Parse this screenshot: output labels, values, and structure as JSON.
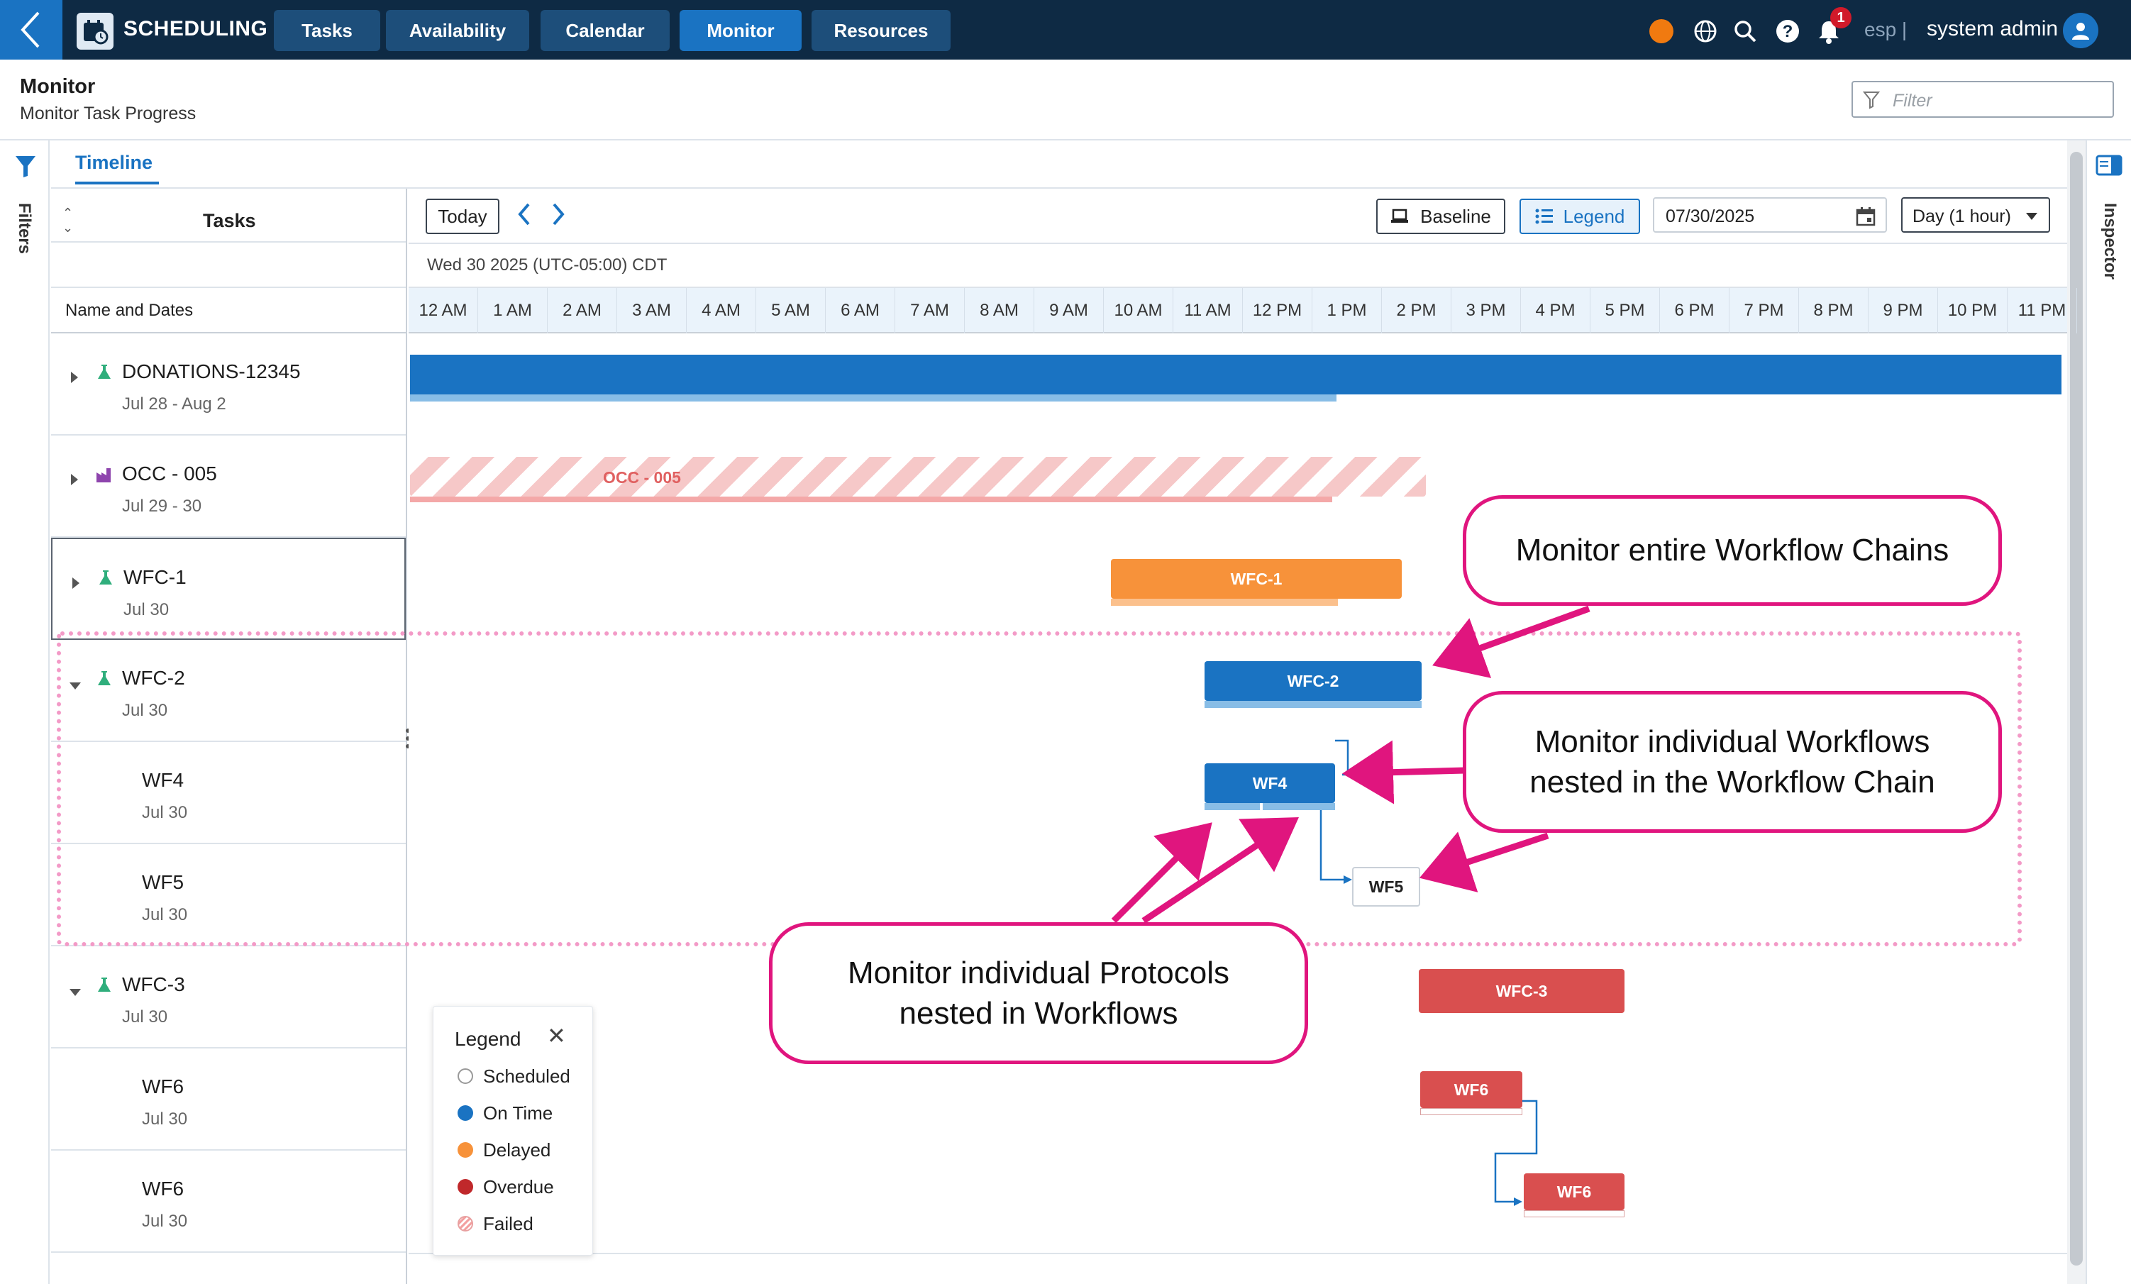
{
  "app": {
    "title": "SCHEDULING"
  },
  "nav": {
    "tabs": [
      "Tasks",
      "Availability",
      "Calendar",
      "Monitor",
      "Resources"
    ],
    "active": "Monitor"
  },
  "topbar": {
    "language": "esp |",
    "user": "system admin",
    "notifications": "1"
  },
  "page": {
    "title": "Monitor",
    "subtitle": "Monitor Task Progress",
    "filter_placeholder": "Filter"
  },
  "rails": {
    "left": "Filters",
    "right": "Inspector"
  },
  "view_tab": "Timeline",
  "tasks_panel": {
    "header": "Tasks",
    "column_label": "Name and Dates"
  },
  "rows": [
    {
      "name": "DONATIONS-12345",
      "dates": "Jul 28 - Aug 2"
    },
    {
      "name": "OCC - 005",
      "dates": "Jul 29 - 30"
    },
    {
      "name": "WFC-1",
      "dates": "Jul 30"
    },
    {
      "name": "WFC-2",
      "dates": "Jul 30"
    },
    {
      "name": "WF4",
      "dates": "Jul 30"
    },
    {
      "name": "WF5",
      "dates": "Jul 30"
    },
    {
      "name": "WFC-3",
      "dates": "Jul 30"
    },
    {
      "name": "WF6",
      "dates": "Jul 30"
    },
    {
      "name": "WF6",
      "dates": "Jul 30"
    }
  ],
  "toolbar": {
    "today": "Today",
    "baseline": "Baseline",
    "legend": "Legend",
    "date": "07/30/2025",
    "scale": "Day (1 hour)"
  },
  "timeline": {
    "day_label": "Wed 30 2025 (UTC-05:00) CDT",
    "hours": [
      "12 AM",
      "1 AM",
      "2 AM",
      "3 AM",
      "4 AM",
      "5 AM",
      "6 AM",
      "7 AM",
      "8 AM",
      "9 AM",
      "10 AM",
      "11 AM",
      "12 PM",
      "1 PM",
      "2 PM",
      "3 PM",
      "4 PM",
      "5 PM",
      "6 PM",
      "7 PM",
      "8 PM",
      "9 PM",
      "10 PM",
      "11 PM"
    ]
  },
  "bars": {
    "occ": "OCC - 005",
    "wfc1": "WFC-1",
    "wfc2": "WFC-2",
    "wf4": "WF4",
    "wf5": "WF5",
    "wfc3": "WFC-3",
    "wf6a": "WF6",
    "wf6b": "WF6"
  },
  "callouts": {
    "chains": "Monitor entire Workflow Chains",
    "workflows": "Monitor individual Workflows nested in the Workflow Chain",
    "protocols": "Monitor individual Protocols nested in Workflows"
  },
  "legend": {
    "title": "Legend",
    "items": [
      "Scheduled",
      "On Time",
      "Delayed",
      "Overdue",
      "Failed"
    ]
  },
  "colors": {
    "on_time": "#1a73c2",
    "delayed": "#f7923a",
    "overdue": "#d94f4f",
    "failed": "#f3b3b3",
    "nav_bg": "#0e2a44",
    "accent": "#e0157e"
  }
}
